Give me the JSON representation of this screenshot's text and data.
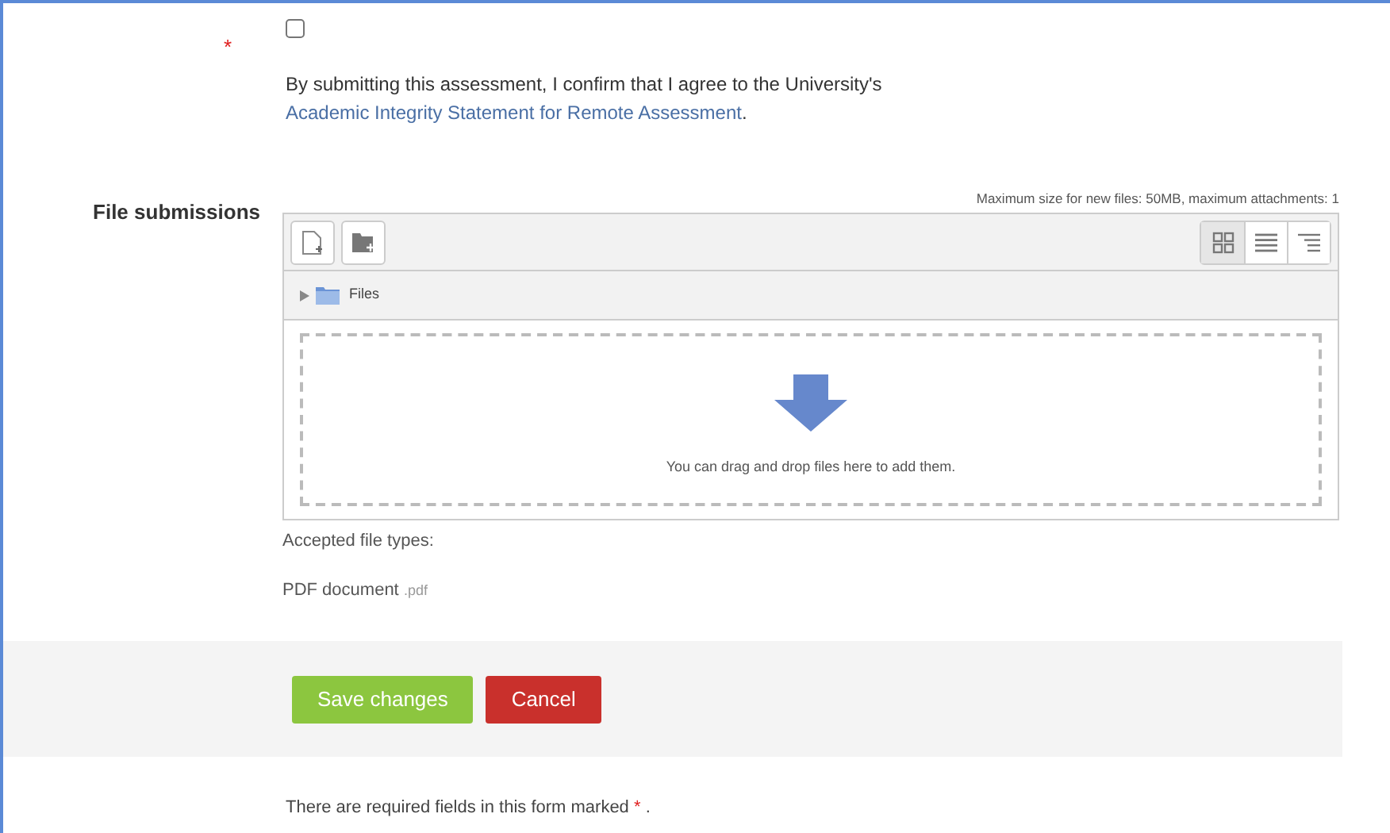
{
  "agreement": {
    "required_mark": "*",
    "checked": false,
    "text_before": "By submitting this assessment, I confirm that I agree to the University's ",
    "link": "Academic Integrity Statement for Remote Assessment",
    "text_after": "."
  },
  "file_submissions": {
    "label": "File submissions",
    "limits": "Maximum size for new files: 50MB, maximum attachments: 1",
    "view_modes": [
      {
        "kind": "icons",
        "selected": true
      },
      {
        "kind": "list",
        "selected": false
      },
      {
        "kind": "tree",
        "selected": false
      }
    ],
    "folder": {
      "name": "Files",
      "expanded": false
    },
    "drop_hint": "You can drag and drop files here to add them.",
    "accepted_label": "Accepted file types:",
    "accepted_type": "PDF document",
    "accepted_ext": ".pdf"
  },
  "buttons": [
    {
      "label": "Save changes",
      "kind": "primary"
    },
    {
      "label": "Cancel",
      "kind": "danger"
    }
  ],
  "footer": {
    "text": "There are required fields in this form marked",
    "mark": "*",
    "end": "."
  }
}
